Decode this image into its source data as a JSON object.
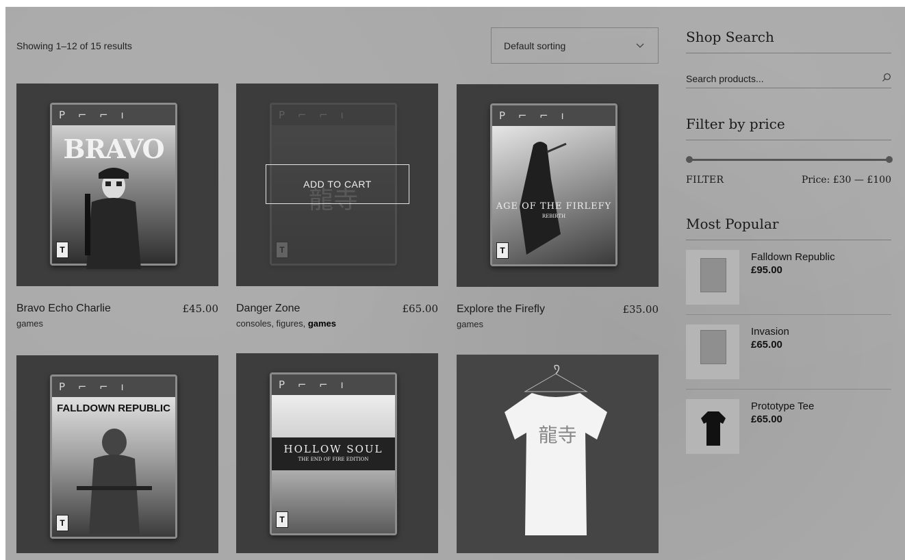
{
  "shop": {
    "result_count": "Showing 1–12 of 15 results",
    "sorting": {
      "selected": "Default sorting"
    },
    "add_to_cart_label": "ADD TO CART"
  },
  "products": [
    {
      "name": "Bravo Echo Charlie",
      "price": "£45.00",
      "categories": [
        "games"
      ],
      "art_title": "BRAVO",
      "art_subtitle": "",
      "rating": "T"
    },
    {
      "name": "Danger Zone",
      "price": "£65.00",
      "categories": [
        "consoles",
        "figures",
        "games"
      ],
      "art_title": "龍寺",
      "art_subtitle": "",
      "rating": "T"
    },
    {
      "name": "Explore the Firefly",
      "price": "£35.00",
      "categories": [
        "games"
      ],
      "art_title": "AGE OF THE FIRLEFY",
      "art_subtitle": "REBIRTH",
      "rating": "T"
    },
    {
      "name": "Falldown Republic",
      "art_title": "FALLDOWN REPUBLIC",
      "rating": "T"
    },
    {
      "name": "Hollow Soul",
      "art_title": "HOLLOW SOUL",
      "art_subtitle": "THE END OF FIRE EDITION",
      "rating": "T"
    },
    {
      "name": "Prototype Tee",
      "art_title": "龍寺"
    }
  ],
  "box_brand": "P ⌐ ⌐ ı",
  "sidebar": {
    "search": {
      "title": "Shop Search",
      "placeholder": "Search products..."
    },
    "price_filter": {
      "title": "Filter by price",
      "button": "FILTER",
      "range_label": "Price: £30 — £100",
      "min_value": 30,
      "max_value": 100
    },
    "popular": {
      "title": "Most Popular",
      "items": [
        {
          "name": "Falldown Republic",
          "price": "£95.00"
        },
        {
          "name": "Invasion",
          "price": "£65.00"
        },
        {
          "name": "Prototype Tee",
          "price": "£65.00"
        }
      ]
    }
  },
  "colors": {
    "page_bg": "#a9a9a9",
    "thumb_bg": "#3d3d3d",
    "text": "#1a1a1a"
  }
}
